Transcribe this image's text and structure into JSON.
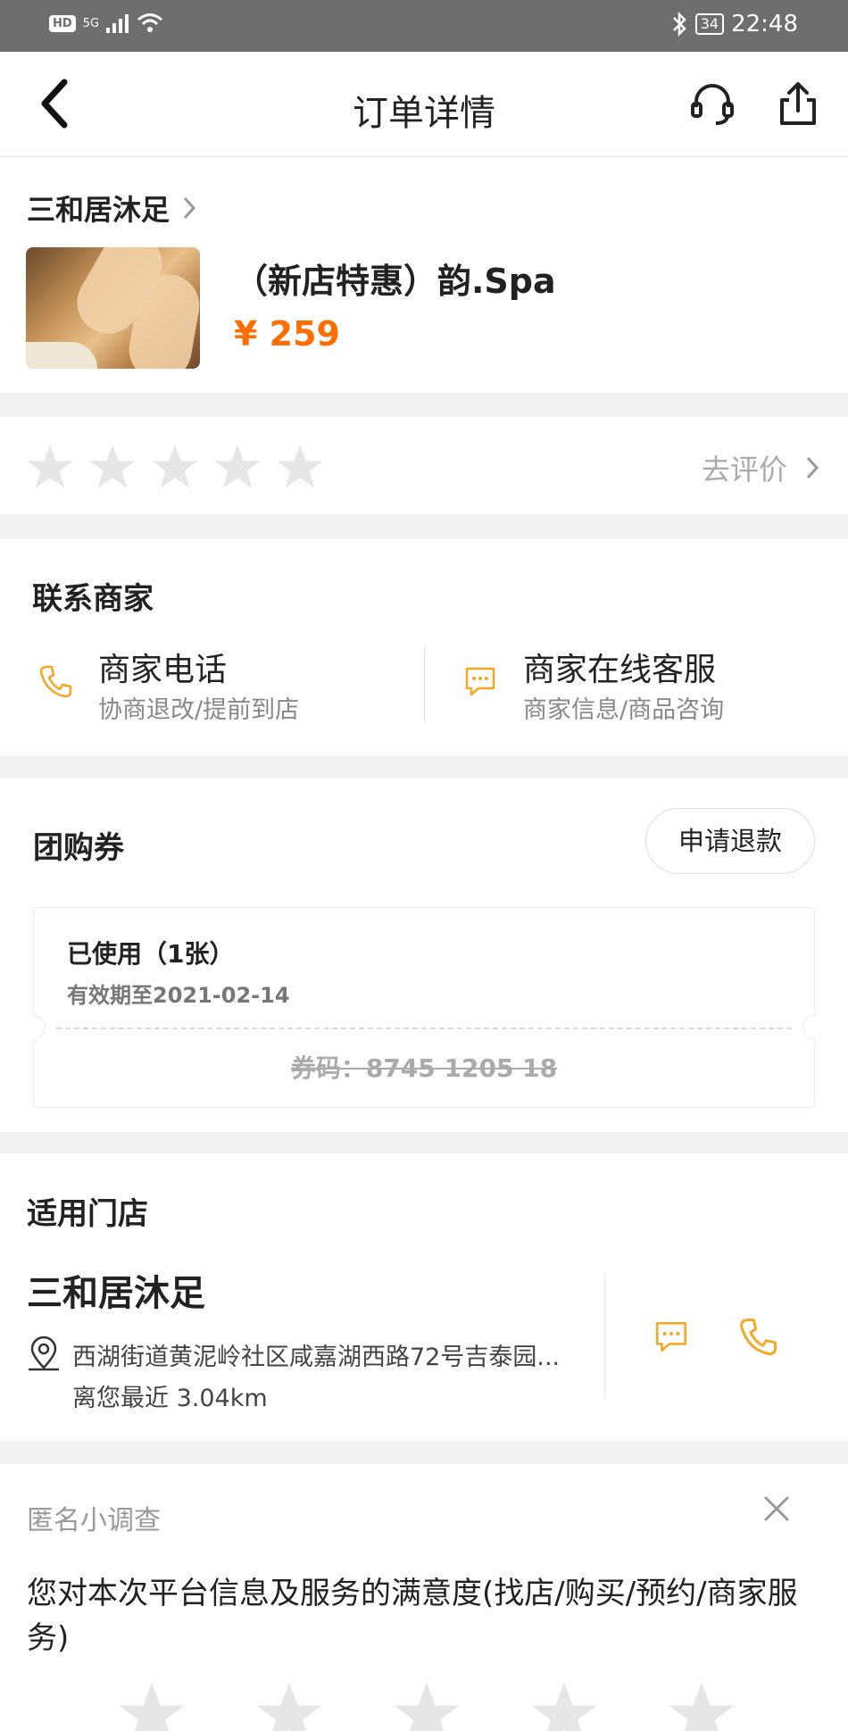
{
  "status_bar": {
    "network": "5G",
    "hd": "HD",
    "battery": "34",
    "time": "22:48"
  },
  "nav": {
    "title": "订单详情",
    "back_icon": "chevron-left-icon",
    "service_icon": "headset-icon",
    "share_icon": "share-icon"
  },
  "shop": {
    "name": "三和居沐足",
    "product_title": "（新店特惠）韵.Spa",
    "price": "¥ 259"
  },
  "rating": {
    "stars": 5,
    "filled": 0,
    "link_label": "去评价"
  },
  "contact": {
    "title": "联系商家",
    "phone": {
      "label": "商家电话",
      "sub": "协商退改/提前到店"
    },
    "online": {
      "label": "商家在线客服",
      "sub": "商家信息/商品咨询"
    }
  },
  "coupon": {
    "title": "团购券",
    "refund_label": "申请退款",
    "status": "已使用（1张）",
    "valid_until": "有效期至2021-02-14",
    "code": "券码：8745 1205 18"
  },
  "store": {
    "title": "适用门店",
    "name": "三和居沐足",
    "address": "西湖街道黄泥岭社区咸嘉湖西路72号吉泰园...",
    "distance": "离您最近 3.04km"
  },
  "survey": {
    "label": "匿名小调查",
    "question": "您对本次平台信息及服务的满意度(找店/购买/预约/商家服务)"
  },
  "colors": {
    "accent": "#ff6d00",
    "icon_orange": "#f5a623",
    "star_gray": "#e6e6e6"
  }
}
